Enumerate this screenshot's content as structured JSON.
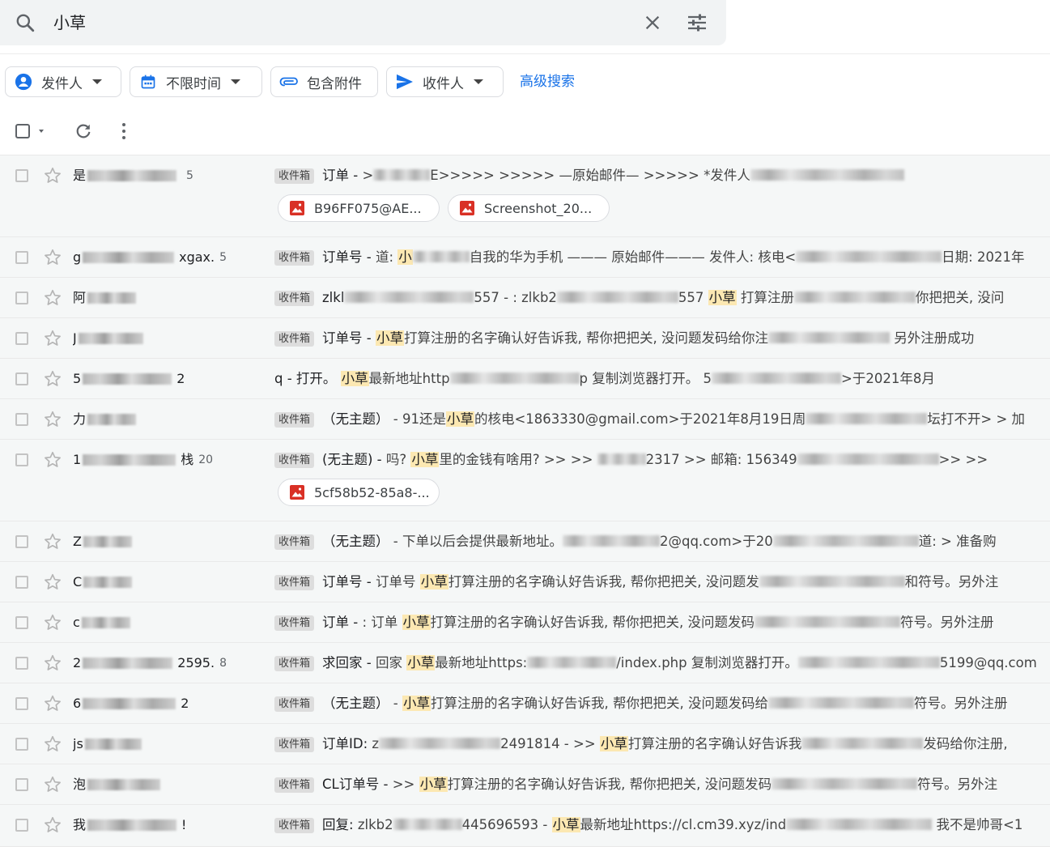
{
  "search": {
    "query": "小草"
  },
  "filters": {
    "sender": "发件人",
    "time": "不限时间",
    "attachment": "包含附件",
    "recipient": "收件人",
    "advanced": "高级搜索"
  },
  "colors": {
    "accent": "#1a73e8",
    "highlight": "#fce8b2",
    "attachment_icon": "#d93025"
  },
  "rows": [
    {
      "sender_first": "是",
      "sender_tail": "",
      "count": "5",
      "tag": "收件箱",
      "subject": "订单 - ",
      "preview_a": ">",
      "preview_b": "E>>>>> >>>>> —原始邮件— >>>>> *发件人",
      "attachments": [
        "B96FF075@AE...",
        "Screenshot_20..."
      ]
    },
    {
      "sender_first": "g",
      "sender_tail": "xgax.",
      "count": "5",
      "tag": "收件箱",
      "subject": "订单号 - ",
      "preview_a": "道:  ",
      "hl1": "小",
      "preview_b": "自我的华为手机 ——— 原始邮件——— 发件人: 核电<",
      "preview_c": "日期: 2021年"
    },
    {
      "sender_first": "阿",
      "sender_tail": "",
      "count": "",
      "tag": "收件箱",
      "subject": "zlkl",
      "preview_a": "557 - : zlkb2",
      "preview_b": "557 ",
      "hl1": "小草",
      "preview_c": " 打算注册",
      "preview_d": "你把把关, 没问"
    },
    {
      "sender_first": "J",
      "sender_tail": "",
      "count": "",
      "tag": "收件箱",
      "subject": "订单号 - ",
      "hl1": "小草",
      "preview_a": "打算注册的名字确认好告诉我, 帮你把把关, 没问题发码给你注",
      "preview_d": " 另外注册成功"
    },
    {
      "sender_first": "5",
      "sender_tail": "2",
      "count": "",
      "tag": "",
      "subject": "q - 打开。 ",
      "hl1": "小草",
      "preview_a": "最新地址http",
      "preview_b": "p 复制浏览器打开。 5",
      "preview_d": ">于2021年8月"
    },
    {
      "sender_first": "力",
      "sender_tail": "",
      "count": "",
      "tag": "收件箱",
      "subject": "（无主题）",
      "preview_a": " - 91还是",
      "hl1": "小草",
      "preview_b": "的核电<1863330@gmail.com>于2021年8月19日周",
      "preview_d": "坛打不开> > 加"
    },
    {
      "sender_first": "1",
      "sender_tail": "栈",
      "count": "20",
      "tag": "收件箱",
      "subject": "(无主题) - ",
      "preview_a": "吗? ",
      "hl1": "小草",
      "preview_b": "里的金钱有啥用?  >> >> ",
      "preview_c": "2317 >> 邮箱: 156349",
      "preview_d": ">> >>",
      "attachments": [
        "5cf58b52-85a8-..."
      ]
    },
    {
      "sender_first": "Z",
      "sender_tail": "",
      "count": "",
      "tag": "收件箱",
      "subject": "（无主题）",
      "preview_a": " - 下单以后会提供最新地址。",
      "preview_b": "2@qq.com>于20",
      "preview_d": "道: > 准备购"
    },
    {
      "sender_first": "C",
      "sender_tail": "",
      "count": "",
      "tag": "收件箱",
      "subject": "订单号 - ",
      "preview_a": "订单号 ",
      "hl1": "小草",
      "preview_b": "打算注册的名字确认好告诉我, 帮你把把关, 没问题发",
      "preview_d": "和符号。另外注"
    },
    {
      "sender_first": "c",
      "sender_tail": "",
      "count": "",
      "tag": "收件箱",
      "subject": "订单 - ",
      "preview_a": ": 订单 ",
      "hl1": "小草",
      "preview_b": "打算注册的名字确认好告诉我, 帮你把把关, 没问题发码",
      "preview_d": "符号。另外注册"
    },
    {
      "sender_first": "2",
      "sender_tail": "2595.",
      "count": "8",
      "tag": "收件箱",
      "subject": "求回家 - ",
      "preview_a": "回家 ",
      "hl1": "小草",
      "preview_b": "最新地址https:",
      "preview_c": "/index.php 复制浏览器打开。",
      "preview_d": "5199@qq.com"
    },
    {
      "sender_first": "6",
      "sender_tail": "2",
      "count": "",
      "tag": "收件箱",
      "subject": "（无主题）",
      "preview_a": " - ",
      "hl1": "小草",
      "preview_b": "打算注册的名字确认好告诉我, 帮你把把关, 没问题发码给",
      "preview_d": "符号。另外注册"
    },
    {
      "sender_first": "js",
      "sender_tail": "",
      "count": "",
      "tag": "收件箱",
      "subject": "订单ID: ",
      "preview_a": "z",
      "preview_b": "2491814 - >> ",
      "hl1": "小草",
      "preview_c": "打算注册的名字确认好告诉我",
      "preview_d": "发码给你注册,"
    },
    {
      "sender_first": "泡",
      "sender_tail": "",
      "count": "",
      "tag": "收件箱",
      "subject": "CL订单号 - ",
      "preview_a": ">> ",
      "hl1": "小草",
      "preview_b": "打算注册的名字确认好告诉我, 帮你把把关, 没问题发码",
      "preview_d": "符号。另外注"
    },
    {
      "sender_first": "我",
      "sender_tail": "!",
      "count": "",
      "tag": "收件箱",
      "subject": "回复: ",
      "preview_a": " zlkb2",
      "preview_b": "445696593 - ",
      "hl1": "小草",
      "preview_c": "最新地址https://cl.cm39.xyz/ind",
      "preview_d": " 我不是帅哥<1"
    }
  ]
}
